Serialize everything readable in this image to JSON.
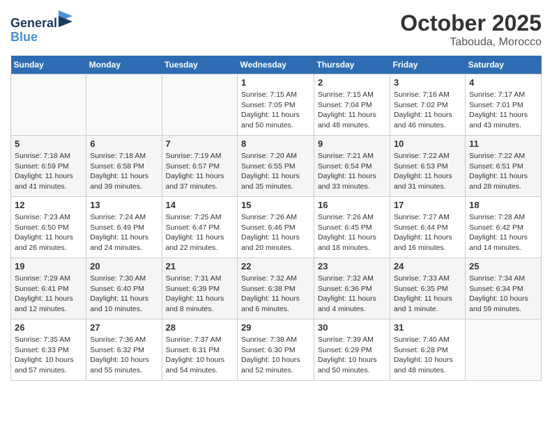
{
  "logo": {
    "line1": "General",
    "line2": "Blue"
  },
  "title": "October 2025",
  "location": "Tabouda, Morocco",
  "weekdays": [
    "Sunday",
    "Monday",
    "Tuesday",
    "Wednesday",
    "Thursday",
    "Friday",
    "Saturday"
  ],
  "weeks": [
    [
      {
        "day": "",
        "info": ""
      },
      {
        "day": "",
        "info": ""
      },
      {
        "day": "",
        "info": ""
      },
      {
        "day": "1",
        "info": "Sunrise: 7:15 AM\nSunset: 7:05 PM\nDaylight: 11 hours\nand 50 minutes."
      },
      {
        "day": "2",
        "info": "Sunrise: 7:15 AM\nSunset: 7:04 PM\nDaylight: 11 hours\nand 48 minutes."
      },
      {
        "day": "3",
        "info": "Sunrise: 7:16 AM\nSunset: 7:02 PM\nDaylight: 11 hours\nand 46 minutes."
      },
      {
        "day": "4",
        "info": "Sunrise: 7:17 AM\nSunset: 7:01 PM\nDaylight: 11 hours\nand 43 minutes."
      }
    ],
    [
      {
        "day": "5",
        "info": "Sunrise: 7:18 AM\nSunset: 6:59 PM\nDaylight: 11 hours\nand 41 minutes."
      },
      {
        "day": "6",
        "info": "Sunrise: 7:18 AM\nSunset: 6:58 PM\nDaylight: 11 hours\nand 39 minutes."
      },
      {
        "day": "7",
        "info": "Sunrise: 7:19 AM\nSunset: 6:57 PM\nDaylight: 11 hours\nand 37 minutes."
      },
      {
        "day": "8",
        "info": "Sunrise: 7:20 AM\nSunset: 6:55 PM\nDaylight: 11 hours\nand 35 minutes."
      },
      {
        "day": "9",
        "info": "Sunrise: 7:21 AM\nSunset: 6:54 PM\nDaylight: 11 hours\nand 33 minutes."
      },
      {
        "day": "10",
        "info": "Sunrise: 7:22 AM\nSunset: 6:53 PM\nDaylight: 11 hours\nand 31 minutes."
      },
      {
        "day": "11",
        "info": "Sunrise: 7:22 AM\nSunset: 6:51 PM\nDaylight: 11 hours\nand 28 minutes."
      }
    ],
    [
      {
        "day": "12",
        "info": "Sunrise: 7:23 AM\nSunset: 6:50 PM\nDaylight: 11 hours\nand 26 minutes."
      },
      {
        "day": "13",
        "info": "Sunrise: 7:24 AM\nSunset: 6:49 PM\nDaylight: 11 hours\nand 24 minutes."
      },
      {
        "day": "14",
        "info": "Sunrise: 7:25 AM\nSunset: 6:47 PM\nDaylight: 11 hours\nand 22 minutes."
      },
      {
        "day": "15",
        "info": "Sunrise: 7:26 AM\nSunset: 6:46 PM\nDaylight: 11 hours\nand 20 minutes."
      },
      {
        "day": "16",
        "info": "Sunrise: 7:26 AM\nSunset: 6:45 PM\nDaylight: 11 hours\nand 18 minutes."
      },
      {
        "day": "17",
        "info": "Sunrise: 7:27 AM\nSunset: 6:44 PM\nDaylight: 11 hours\nand 16 minutes."
      },
      {
        "day": "18",
        "info": "Sunrise: 7:28 AM\nSunset: 6:42 PM\nDaylight: 11 hours\nand 14 minutes."
      }
    ],
    [
      {
        "day": "19",
        "info": "Sunrise: 7:29 AM\nSunset: 6:41 PM\nDaylight: 11 hours\nand 12 minutes."
      },
      {
        "day": "20",
        "info": "Sunrise: 7:30 AM\nSunset: 6:40 PM\nDaylight: 11 hours\nand 10 minutes."
      },
      {
        "day": "21",
        "info": "Sunrise: 7:31 AM\nSunset: 6:39 PM\nDaylight: 11 hours\nand 8 minutes."
      },
      {
        "day": "22",
        "info": "Sunrise: 7:32 AM\nSunset: 6:38 PM\nDaylight: 11 hours\nand 6 minutes."
      },
      {
        "day": "23",
        "info": "Sunrise: 7:32 AM\nSunset: 6:36 PM\nDaylight: 11 hours\nand 4 minutes."
      },
      {
        "day": "24",
        "info": "Sunrise: 7:33 AM\nSunset: 6:35 PM\nDaylight: 11 hours\nand 1 minute."
      },
      {
        "day": "25",
        "info": "Sunrise: 7:34 AM\nSunset: 6:34 PM\nDaylight: 10 hours\nand 59 minutes."
      }
    ],
    [
      {
        "day": "26",
        "info": "Sunrise: 7:35 AM\nSunset: 6:33 PM\nDaylight: 10 hours\nand 57 minutes."
      },
      {
        "day": "27",
        "info": "Sunrise: 7:36 AM\nSunset: 6:32 PM\nDaylight: 10 hours\nand 55 minutes."
      },
      {
        "day": "28",
        "info": "Sunrise: 7:37 AM\nSunset: 6:31 PM\nDaylight: 10 hours\nand 54 minutes."
      },
      {
        "day": "29",
        "info": "Sunrise: 7:38 AM\nSunset: 6:30 PM\nDaylight: 10 hours\nand 52 minutes."
      },
      {
        "day": "30",
        "info": "Sunrise: 7:39 AM\nSunset: 6:29 PM\nDaylight: 10 hours\nand 50 minutes."
      },
      {
        "day": "31",
        "info": "Sunrise: 7:40 AM\nSunset: 6:28 PM\nDaylight: 10 hours\nand 48 minutes."
      },
      {
        "day": "",
        "info": ""
      }
    ]
  ]
}
